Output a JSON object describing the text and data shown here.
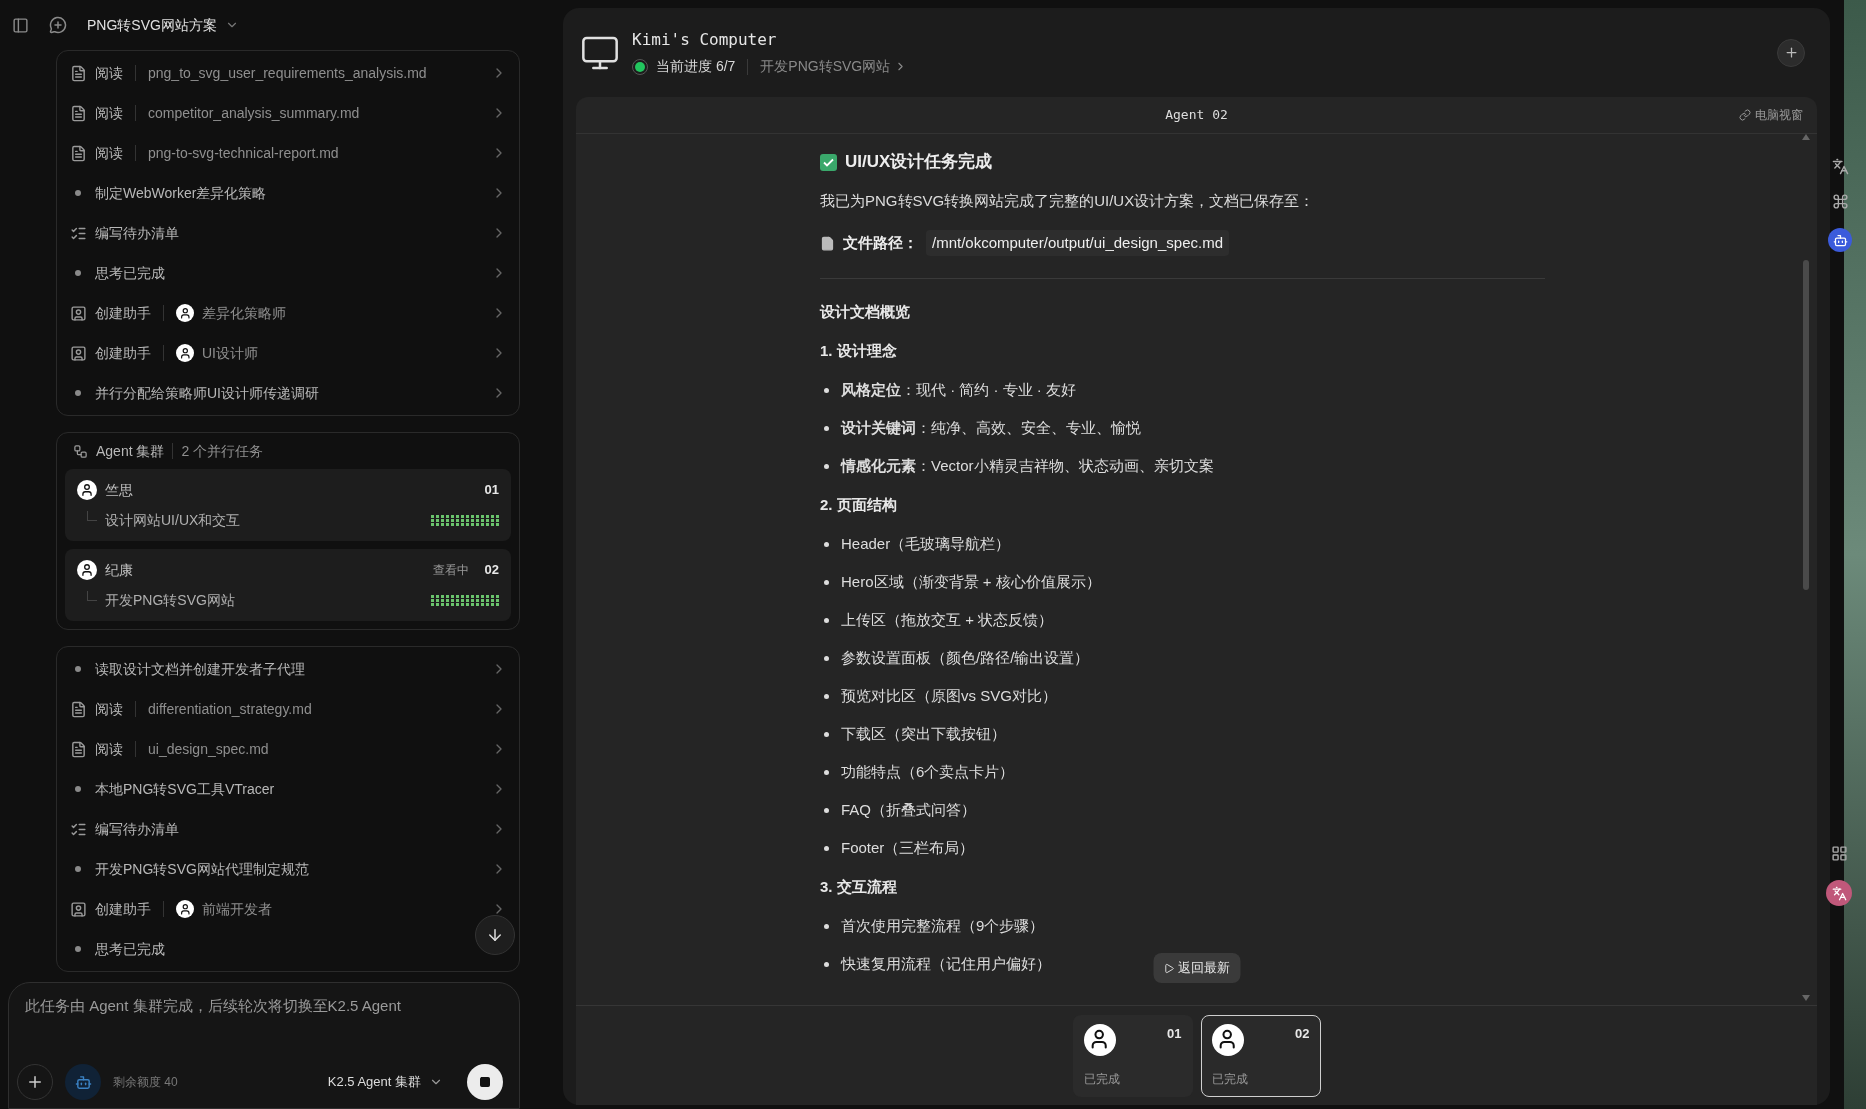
{
  "topbar": {
    "title": "PNG转SVG网站方案"
  },
  "steps_top": [
    {
      "kind": "read",
      "action": "阅读",
      "target": "png_to_svg_user_requirements_analysis.md",
      "chevron": true
    },
    {
      "kind": "read",
      "action": "阅读",
      "target": "competitor_analysis_summary.md",
      "chevron": true
    },
    {
      "kind": "read",
      "action": "阅读",
      "target": "png-to-svg-technical-report.md",
      "chevron": true
    },
    {
      "kind": "note",
      "action": "制定WebWorker差异化策略",
      "chevron": true
    },
    {
      "kind": "todo",
      "action": "编写待办清单",
      "chevron": true
    },
    {
      "kind": "note",
      "action": "思考已完成",
      "chevron": true
    },
    {
      "kind": "assistant",
      "action": "创建助手",
      "target": "差异化策略师",
      "chevron": true
    },
    {
      "kind": "assistant",
      "action": "创建助手",
      "target": "UI设计师",
      "chevron": true
    },
    {
      "kind": "note",
      "action": "并行分配给策略师UI设计师传递调研",
      "chevron": true
    }
  ],
  "cluster": {
    "title": "Agent 集群",
    "count": "2 个并行任务",
    "agents": [
      {
        "name": "竺思",
        "number": "01",
        "task": "设计网站UI/UX和交互"
      },
      {
        "name": "纪康",
        "status": "查看中",
        "number": "02",
        "task": "开发PNG转SVG网站"
      }
    ]
  },
  "steps_bottom": [
    {
      "kind": "note",
      "action": "读取设计文档并创建开发者子代理",
      "chevron": true
    },
    {
      "kind": "read",
      "action": "阅读",
      "target": "differentiation_strategy.md",
      "chevron": true
    },
    {
      "kind": "read",
      "action": "阅读",
      "target": "ui_design_spec.md",
      "chevron": true
    },
    {
      "kind": "note",
      "action": "本地PNG转SVG工具VTracer",
      "chevron": true
    },
    {
      "kind": "todo",
      "action": "编写待办清单",
      "chevron": true
    },
    {
      "kind": "note",
      "action": "开发PNG转SVG网站代理制定规范",
      "chevron": true
    },
    {
      "kind": "assistant",
      "action": "创建助手",
      "target": "前端开发者",
      "chevron": true
    },
    {
      "kind": "note",
      "action": "思考已完成",
      "chevron": false
    }
  ],
  "composer": {
    "text": "此任务由 Agent 集群完成，后续轮次将切换至K2.5 Agent",
    "quota": "剩余额度 40",
    "model": "K2.5 Agent 集群"
  },
  "computer": {
    "title": "Kimi's Computer",
    "progress": "当前进度 6/7",
    "task": "开发PNG转SVG网站"
  },
  "viewer": {
    "title": "Agent 02",
    "window_link": "电脑视窗"
  },
  "document": {
    "heading": "UI/UX设计任务完成",
    "intro": "我已为PNG转SVG转换网站完成了完整的UI/UX设计方案，文档已保存至：",
    "file_label": "文件路径：",
    "file_path": "/mnt/okcomputer/output/ui_design_spec.md",
    "overview": "设计文档概览",
    "sections": [
      {
        "title": "1. 设计理念",
        "items": [
          "**风格定位**：现代 · 简约 · 专业 · 友好",
          "**设计关键词**：纯净、高效、安全、专业、愉悦",
          "**情感化元素**：Vector小精灵吉祥物、状态动画、亲切文案"
        ]
      },
      {
        "title": "2. 页面结构",
        "items": [
          "Header（毛玻璃导航栏）",
          "Hero区域（渐变背景 + 核心价值展示）",
          "上传区（拖放交互 + 状态反馈）",
          "参数设置面板（颜色/路径/输出设置）",
          "预览对比区（原图vs SVG对比）",
          "下载区（突出下载按钮）",
          "功能特点（6个卖点卡片）",
          "FAQ（折叠式问答）",
          "Footer（三栏布局）"
        ]
      },
      {
        "title": "3. 交互流程",
        "items": [
          "首次使用完整流程（9个步骤）",
          "快速复用流程（记住用户偏好）"
        ]
      }
    ]
  },
  "return_button": "返回最新",
  "agent_tabs": [
    {
      "number": "01",
      "status": "已完成",
      "selected": false
    },
    {
      "number": "02",
      "status": "已完成",
      "selected": true
    }
  ]
}
